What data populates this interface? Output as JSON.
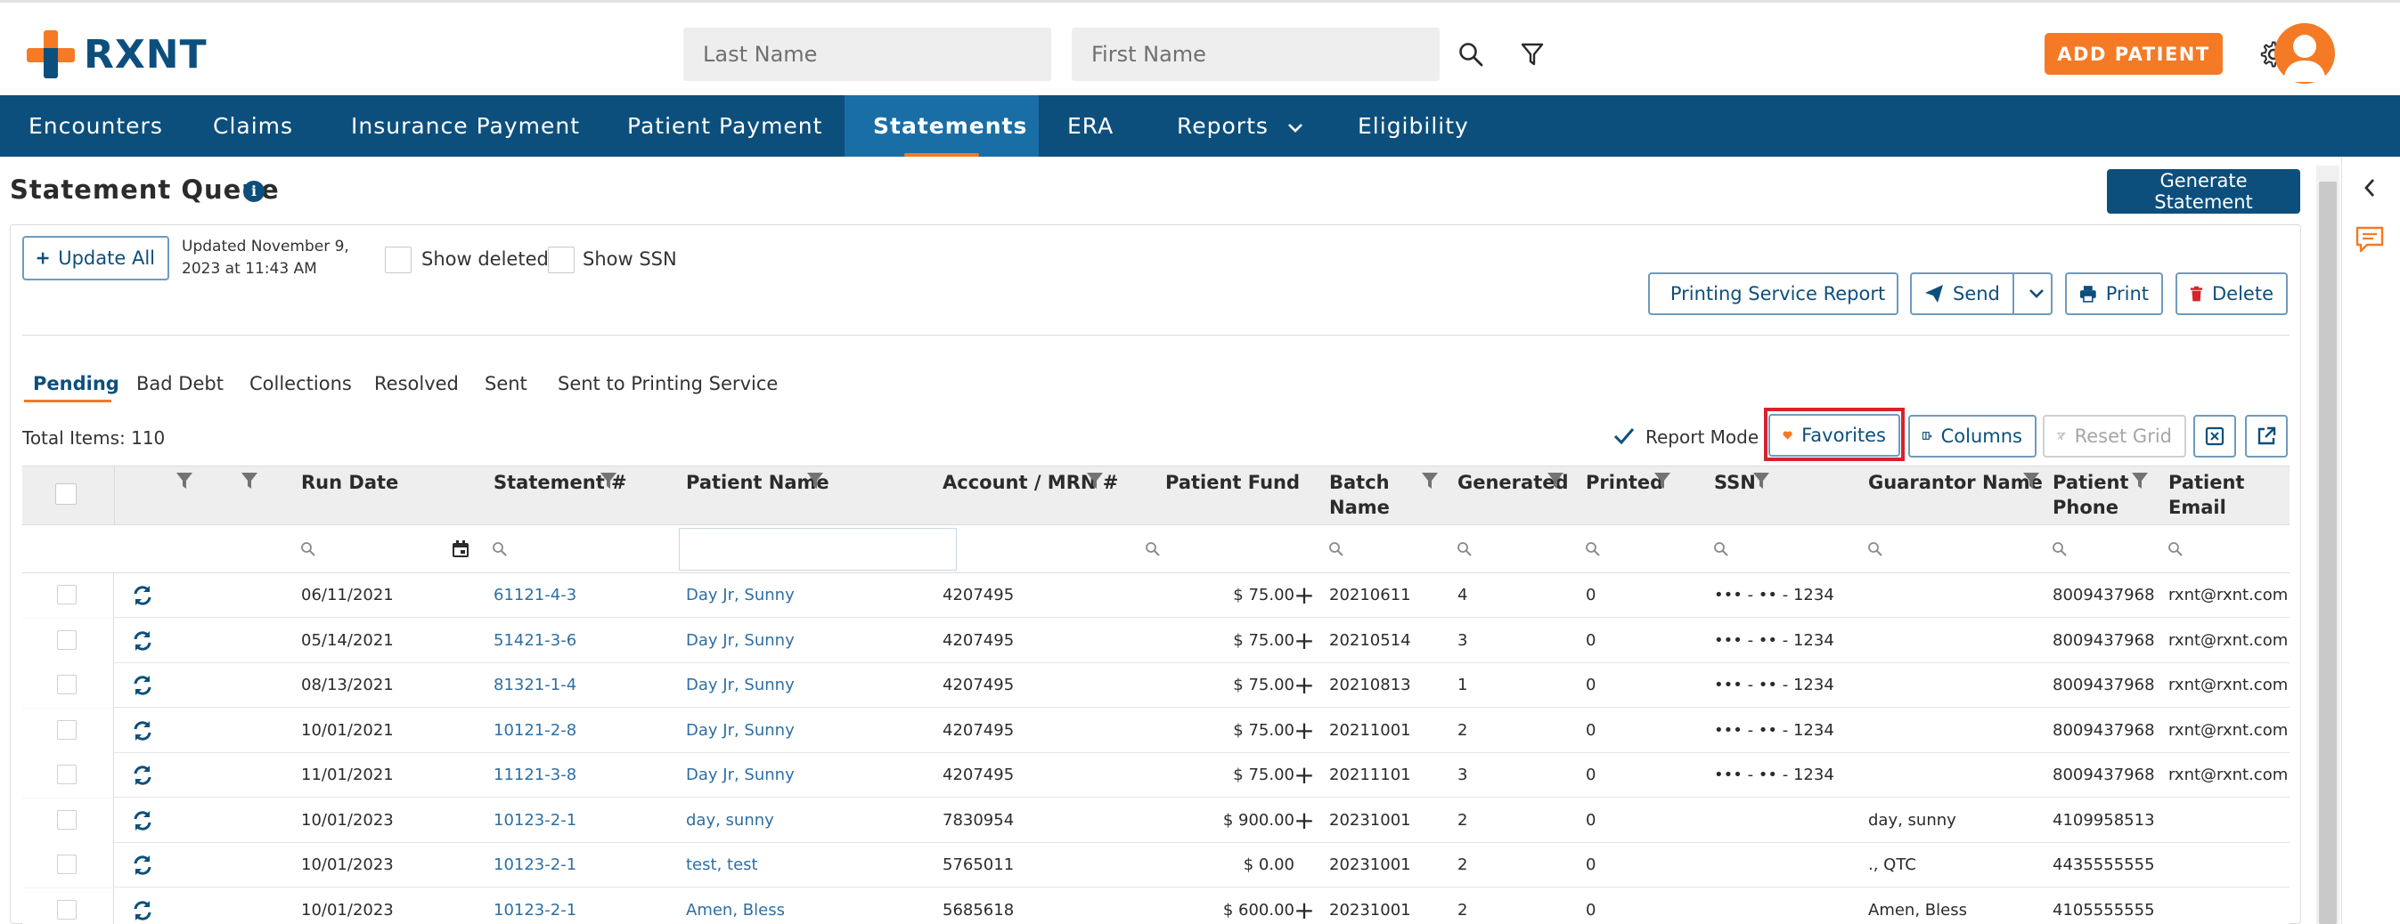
{
  "app": {
    "logo_text": "RXNT"
  },
  "search": {
    "last_name_placeholder": "Last Name",
    "first_name_placeholder": "First Name"
  },
  "header": {
    "add_patient_label": "ADD PATIENT"
  },
  "nav": {
    "items": [
      {
        "label": "Encounters"
      },
      {
        "label": "Claims"
      },
      {
        "label": "Insurance Payment"
      },
      {
        "label": "Patient Payment"
      },
      {
        "label": "Statements"
      },
      {
        "label": "ERA"
      },
      {
        "label": "Reports"
      },
      {
        "label": "Eligibility"
      }
    ],
    "active": "Statements"
  },
  "page": {
    "title": "Statement Queue",
    "generate_statement_label": "Generate Statement"
  },
  "toolbar": {
    "update_all_label": "Update All",
    "updated_text": "Updated November 9, 2023 at 11:43 AM",
    "show_deleted_label": "Show deleted",
    "show_ssn_label": "Show SSN",
    "printing_service_report_label": "Printing Service Report",
    "send_label": "Send",
    "print_label": "Print",
    "delete_label": "Delete"
  },
  "tabs": [
    {
      "label": "Pending"
    },
    {
      "label": "Bad Debt"
    },
    {
      "label": "Collections"
    },
    {
      "label": "Resolved"
    },
    {
      "label": "Sent"
    },
    {
      "label": "Sent to Printing Service"
    }
  ],
  "grid_toolbar": {
    "total_items": "Total Items: 110",
    "report_mode_label": "Report Mode",
    "report_mode_checked": true,
    "favorites_label": "Favorites",
    "columns_label": "Columns",
    "reset_grid_label": "Reset Grid"
  },
  "grid": {
    "headers": {
      "run_date": "Run Date",
      "statement": "Statement #",
      "patient_name": "Patient Name",
      "account": "Account / MRN #",
      "patient_fund": "Patient Fund",
      "batch_name_1": "Batch",
      "batch_name_2": "Name",
      "generated": "Generated",
      "printed": "Printed",
      "ssn": "SSN",
      "guarantor": "Guarantor Name",
      "patient_phone_1": "Patient",
      "patient_phone_2": "Phone",
      "patient_email": "Patient Email"
    },
    "rows": [
      {
        "run_date": "06/11/2021",
        "statement": "61121-4-3",
        "patient": "Day Jr, Sunny",
        "account": "4207495",
        "fund": "$ 75.00",
        "plus": "+",
        "batch": "20210611",
        "generated": "4",
        "printed": "0",
        "ssn": "••• - •• - 1234",
        "guarantor": "",
        "phone": "8009437968",
        "email": "rxnt@rxnt.com"
      },
      {
        "run_date": "05/14/2021",
        "statement": "51421-3-6",
        "patient": "Day Jr, Sunny",
        "account": "4207495",
        "fund": "$ 75.00",
        "plus": "+",
        "batch": "20210514",
        "generated": "3",
        "printed": "0",
        "ssn": "••• - •• - 1234",
        "guarantor": "",
        "phone": "8009437968",
        "email": "rxnt@rxnt.com"
      },
      {
        "run_date": "08/13/2021",
        "statement": "81321-1-4",
        "patient": "Day Jr, Sunny",
        "account": "4207495",
        "fund": "$ 75.00",
        "plus": "+",
        "batch": "20210813",
        "generated": "1",
        "printed": "0",
        "ssn": "••• - •• - 1234",
        "guarantor": "",
        "phone": "8009437968",
        "email": "rxnt@rxnt.com"
      },
      {
        "run_date": "10/01/2021",
        "statement": "10121-2-8",
        "patient": "Day Jr, Sunny",
        "account": "4207495",
        "fund": "$ 75.00",
        "plus": "+",
        "batch": "20211001",
        "generated": "2",
        "printed": "0",
        "ssn": "••• - •• - 1234",
        "guarantor": "",
        "phone": "8009437968",
        "email": "rxnt@rxnt.com"
      },
      {
        "run_date": "11/01/2021",
        "statement": "11121-3-8",
        "patient": "Day Jr, Sunny",
        "account": "4207495",
        "fund": "$ 75.00",
        "plus": "+",
        "batch": "20211101",
        "generated": "3",
        "printed": "0",
        "ssn": "••• - •• - 1234",
        "guarantor": "",
        "phone": "8009437968",
        "email": "rxnt@rxnt.com"
      },
      {
        "run_date": "10/01/2023",
        "statement": "10123-2-1",
        "patient": "day, sunny",
        "account": "7830954",
        "fund": "$ 900.00",
        "plus": "+",
        "batch": "20231001",
        "generated": "2",
        "printed": "0",
        "ssn": "",
        "guarantor": "day, sunny",
        "phone": "4109958513",
        "email": ""
      },
      {
        "run_date": "10/01/2023",
        "statement": "10123-2-1",
        "patient": "test, test",
        "account": "5765011",
        "fund": "$ 0.00",
        "plus": "",
        "batch": "20231001",
        "generated": "2",
        "printed": "0",
        "ssn": "",
        "guarantor": "., QTC",
        "phone": "4435555555",
        "email": ""
      },
      {
        "run_date": "10/01/2023",
        "statement": "10123-2-1",
        "patient": "Amen, Bless",
        "account": "5685618",
        "fund": "$ 600.00",
        "plus": "+",
        "batch": "20231001",
        "generated": "2",
        "printed": "0",
        "ssn": "",
        "guarantor": "Amen, Bless",
        "phone": "4105555555",
        "email": ""
      }
    ]
  },
  "colors": {
    "brand_navy": "#0d4f7c",
    "brand_orange": "#f47a25",
    "nav_active": "#1a6ea6",
    "link": "#2e6fa3",
    "highlight_red": "#d6232c"
  }
}
